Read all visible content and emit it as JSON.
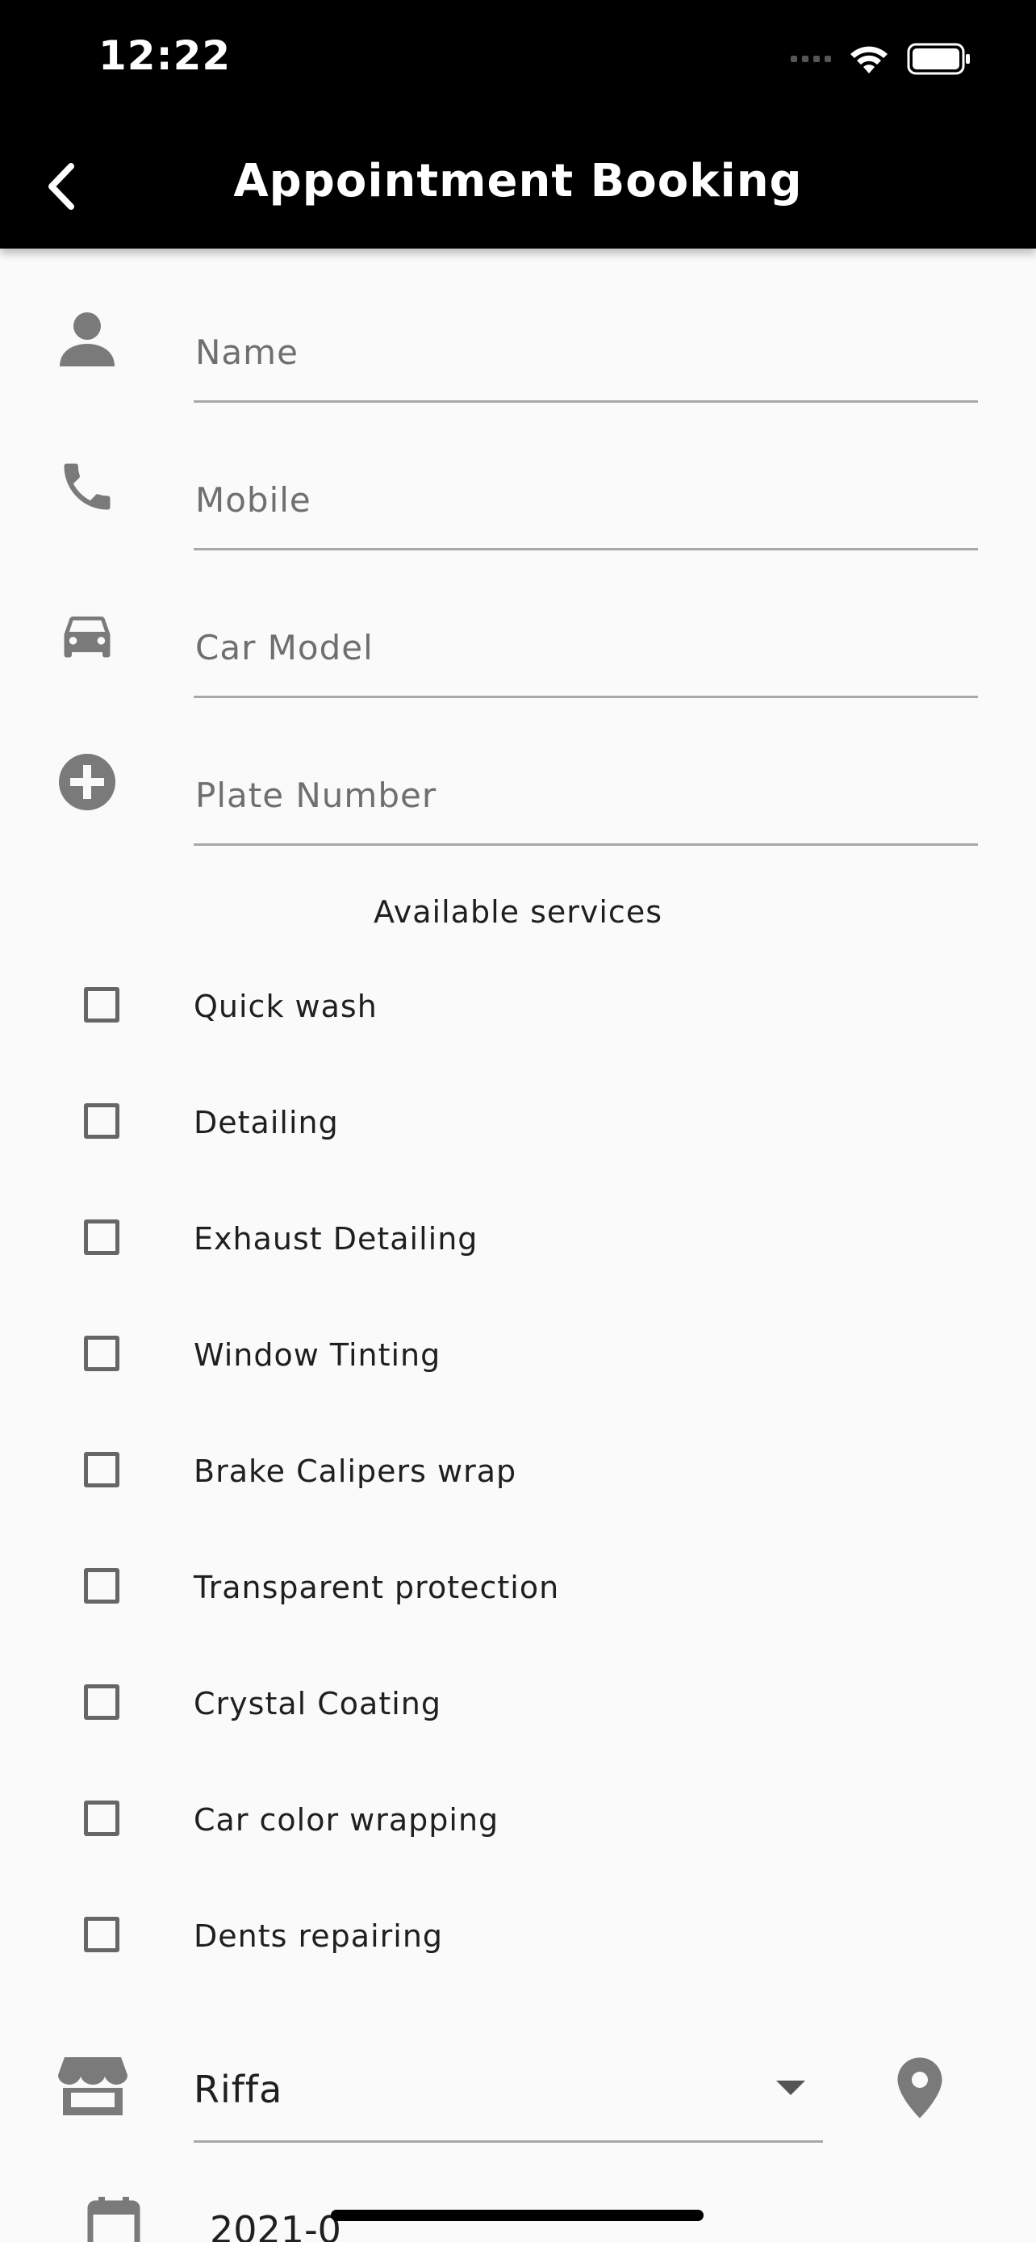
{
  "status_bar": {
    "time": "12:22"
  },
  "app_bar": {
    "title": "Appointment Booking"
  },
  "form": {
    "name": {
      "placeholder": "Name",
      "value": ""
    },
    "mobile": {
      "placeholder": "Mobile",
      "value": ""
    },
    "car_model": {
      "placeholder": "Car Model",
      "value": ""
    },
    "plate_number": {
      "placeholder": "Plate Number",
      "value": ""
    }
  },
  "services": {
    "title": "Available services",
    "items": [
      {
        "label": "Quick wash",
        "checked": false
      },
      {
        "label": "Detailing",
        "checked": false
      },
      {
        "label": "Exhaust Detailing",
        "checked": false
      },
      {
        "label": "Window Tinting",
        "checked": false
      },
      {
        "label": "Brake Calipers wrap",
        "checked": false
      },
      {
        "label": "Transparent protection",
        "checked": false
      },
      {
        "label": "Crystal Coating",
        "checked": false
      },
      {
        "label": "Car color wrapping",
        "checked": false
      },
      {
        "label": "Dents repairing",
        "checked": false
      }
    ]
  },
  "branch": {
    "selected": "Riffa"
  },
  "date": {
    "value": "2021-0"
  },
  "colors": {
    "app_bar": "#000000",
    "background": "#fafafa",
    "icon": "#7a7a7a",
    "underline": "#a8a8a8"
  }
}
